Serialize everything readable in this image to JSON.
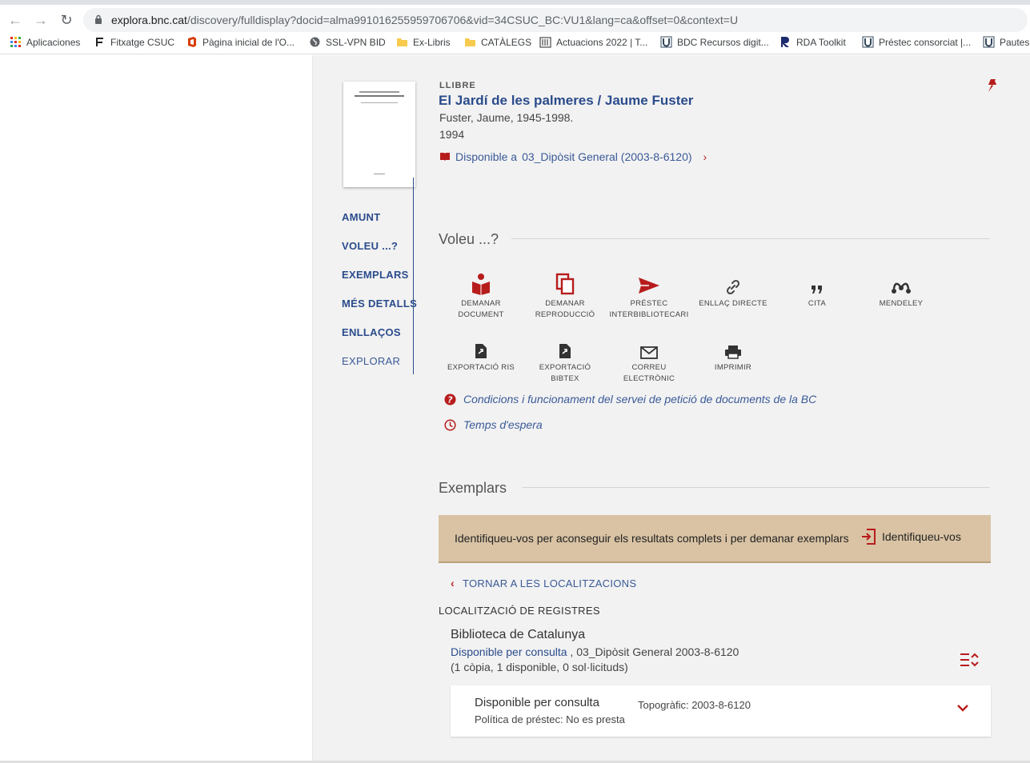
{
  "browser": {
    "url_host": "explora.bnc.cat",
    "url_path": "/discovery/fulldisplay?docid=alma991016255959706706&vid=34CSUC_BC:VU1&lang=ca&offset=0&context=U",
    "bookmarks": [
      {
        "label": "Aplicaciones",
        "icon": "apps-grid-icon"
      },
      {
        "label": "Fitxatge CSUC",
        "icon": "fitxatge-icon"
      },
      {
        "label": "Pàgina inicial de l'O...",
        "icon": "office-icon"
      },
      {
        "label": "SSL-VPN BID",
        "icon": "globe-icon"
      },
      {
        "label": "Ex-Libris",
        "icon": "folder-icon"
      },
      {
        "label": "CATÀLEGS",
        "icon": "folder-icon"
      },
      {
        "label": "Actuacions 2022 | T...",
        "icon": "building-icon"
      },
      {
        "label": "BDC Recursos digit...",
        "icon": "u-icon"
      },
      {
        "label": "RDA Toolkit",
        "icon": "r-icon"
      },
      {
        "label": "Préstec consorciat |...",
        "icon": "u-icon"
      },
      {
        "label": "Pautes",
        "icon": "u-icon"
      }
    ]
  },
  "record": {
    "type": "LLIBRE",
    "title": "El Jardí de les palmeres / Jaume Fuster",
    "author": "Fuster, Jaume, 1945-1998.",
    "year": "1994",
    "availability_prefix": "Disponible a",
    "availability_location": "03_Dipòsit General (2003-8-6120)"
  },
  "sidenav": [
    "AMUNT",
    "VOLEU ...?",
    "EXEMPLARS",
    "MÉS DETALLS",
    "ENLLAÇOS",
    "EXPLORAR"
  ],
  "voleu": {
    "heading": "Voleu ...?",
    "actions": [
      {
        "label1": "DEMANAR",
        "label2": "DOCUMENT",
        "icon": "request-book-icon"
      },
      {
        "label1": "DEMANAR",
        "label2": "REPRODUCCIÓ",
        "icon": "copy-icon"
      },
      {
        "label1": "PRÉSTEC",
        "label2": "INTERBIBLIOTECARI",
        "icon": "send-icon"
      },
      {
        "label1": "ENLLAÇ DIRECTE",
        "label2": "",
        "icon": "link-icon"
      },
      {
        "label1": "CITA",
        "label2": "",
        "icon": "quote-icon"
      },
      {
        "label1": "MENDELEY",
        "label2": "",
        "icon": "mendeley-icon"
      },
      {
        "label1": "EXPORTACIÓ RIS",
        "label2": "",
        "icon": "export-ris-icon"
      },
      {
        "label1": "EXPORTACIÓ",
        "label2": "BIBTEX",
        "icon": "export-bibtex-icon"
      },
      {
        "label1": "CORREU",
        "label2": "ELECTRÒNIC",
        "icon": "email-icon"
      },
      {
        "label1": "IMPRIMIR",
        "label2": "",
        "icon": "print-icon"
      }
    ],
    "conditions_link": "Condicions i funcionament del servei de petició de documents de la BC",
    "wait_link": "Temps d'espera"
  },
  "exemplars": {
    "heading": "Exemplars",
    "login_message": "Identifiqueu-vos per aconseguir els resultats complets i per demanar exemplars",
    "login_button": "Identifiqueu-vos",
    "back_link": "TORNAR A LES LOCALITZACIONS",
    "location_heading": "LOCALITZACIÓ DE REGISTRES",
    "library": "Biblioteca de Catalunya",
    "status_link": "Disponible per consulta",
    "location_detail": ", 03_Dipòsit General 2003-8-6120",
    "copies": "(1 còpia, 1 disponible, 0 sol·licituds)",
    "item": {
      "status": "Disponible per consulta",
      "policy": "Política de préstec: No es presta",
      "topographic": "Topogràfic: 2003-8-6120"
    }
  },
  "colors": {
    "accent_red": "#b71c1c",
    "link_blue": "#2b4c8c",
    "banner": "#d9c3a4"
  }
}
